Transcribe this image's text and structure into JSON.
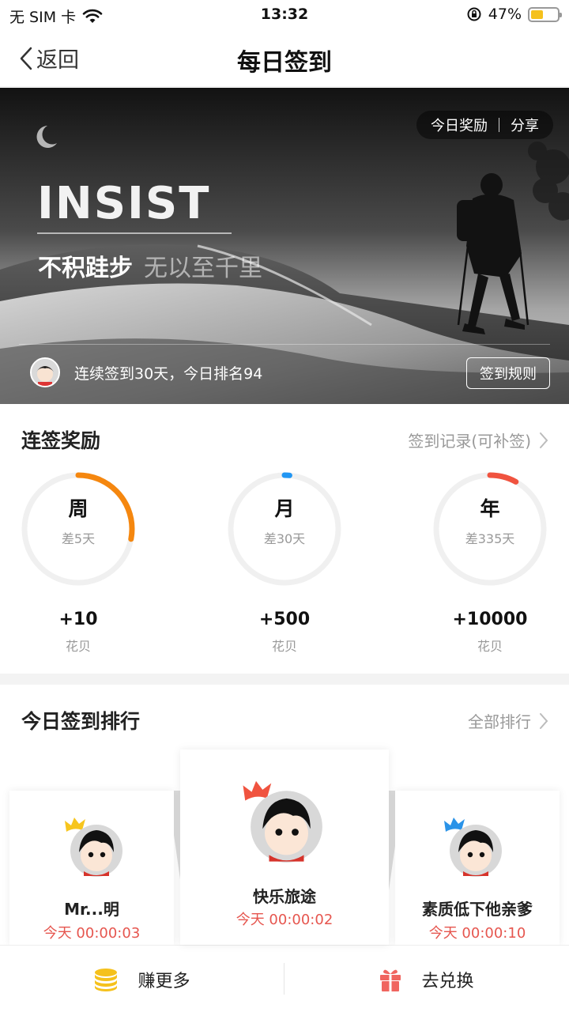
{
  "status_bar": {
    "carrier": "无 SIM 卡",
    "time": "13:32",
    "battery_pct": "47%",
    "battery_level": 0.47
  },
  "nav": {
    "back_label": "返回",
    "title": "每日签到"
  },
  "banner": {
    "pill_reward": "今日奖励",
    "pill_share": "分享",
    "headline": "INSIST",
    "subtitle_main": "不积跬步",
    "subtitle_rest": "无以至千里",
    "info": "连续签到30天，今日排名94",
    "rules_button": "签到规则"
  },
  "streak": {
    "title": "连签奖励",
    "link": "签到记录(可补签)",
    "rewards": [
      {
        "label": "周",
        "diff": "差5天",
        "amount": "+10",
        "unit": "花贝",
        "progress": 0.28,
        "color": "#f5870f"
      },
      {
        "label": "月",
        "diff": "差30天",
        "amount": "+500",
        "unit": "花贝",
        "progress": 0.015,
        "color": "#2196f3"
      },
      {
        "label": "年",
        "diff": "差335天",
        "amount": "+10000",
        "unit": "花贝",
        "progress": 0.08,
        "color": "#f0533f"
      }
    ]
  },
  "ranking": {
    "title": "今日签到排行",
    "link": "全部排行",
    "entries": [
      {
        "name": "Mr...明",
        "time": "今天 00:00:03",
        "crown_color": "#f7c51e"
      },
      {
        "name": "快乐旅途",
        "time": "今天 00:00:02",
        "crown_color": "#f0533f"
      },
      {
        "name": "素质低下他亲爹",
        "time": "今天 00:00:10",
        "crown_color": "#2a93e8"
      }
    ]
  },
  "bottom": {
    "earn_more": "赚更多",
    "redeem": "去兑换"
  },
  "colors": {
    "accent_red": "#e6564f",
    "coin": "#f5c11c",
    "gift": "#f0655f"
  }
}
